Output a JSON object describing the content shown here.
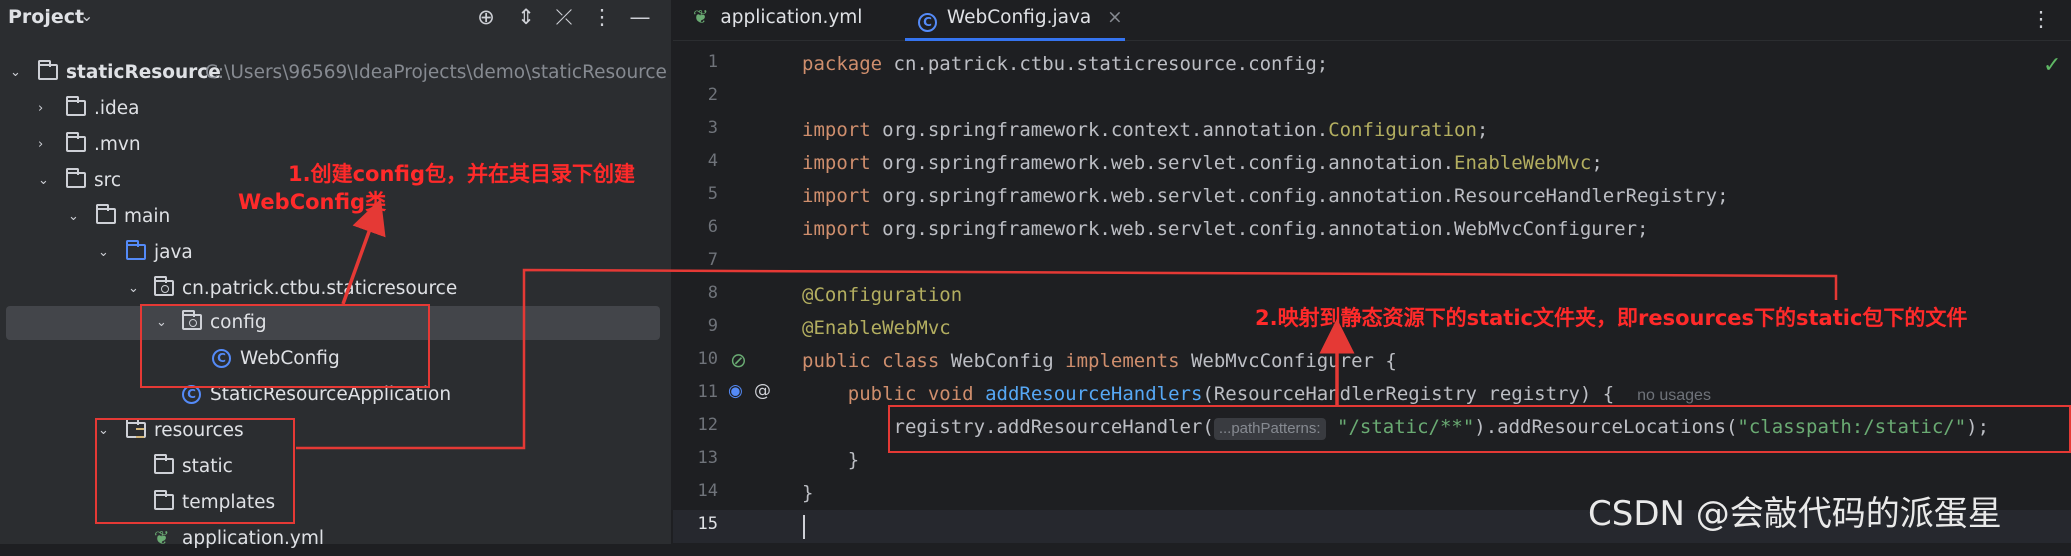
{
  "project_panel": {
    "title": "Project",
    "tree": [
      {
        "label": "staticResource",
        "path": "C:\\Users\\96569\\IdeaProjects\\demo\\staticResource"
      },
      {
        "label": ".idea"
      },
      {
        "label": ".mvn"
      },
      {
        "label": "src"
      },
      {
        "label": "main"
      },
      {
        "label": "java"
      },
      {
        "label": "cn.patrick.ctbu.staticresource"
      },
      {
        "label": "config"
      },
      {
        "label": "WebConfig"
      },
      {
        "label": "StaticResourceApplication"
      },
      {
        "label": "resources"
      },
      {
        "label": "static"
      },
      {
        "label": "templates"
      },
      {
        "label": "application.yml"
      }
    ]
  },
  "editor": {
    "tabs": [
      {
        "label": "application.yml",
        "active": false
      },
      {
        "label": "WebConfig.java",
        "active": true
      }
    ],
    "line_numbers": [
      "1",
      "2",
      "3",
      "4",
      "5",
      "6",
      "7",
      "8",
      "9",
      "10",
      "11",
      "12",
      "13",
      "14",
      "15"
    ],
    "code": {
      "l1_kw": "package",
      "l1_rest": " cn.patrick.ctbu.staticresource.config;",
      "import_kw": "import",
      "l3_pre": " org.springframework.context.annotation.",
      "l3_cls": "Configuration",
      "l4_pre": " org.springframework.web.servlet.config.annotation.",
      "l4_cls": "EnableWebMvc",
      "l5_rest": " org.springframework.web.servlet.config.annotation.ResourceHandlerRegistry;",
      "l6_rest": " org.springframework.web.servlet.config.annotation.WebMvcConfigurer;",
      "semicolon": ";",
      "l8": "@Configuration",
      "l9": "@EnableWebMvc",
      "l10_kw1": "public class",
      "l10_name": " WebConfig ",
      "l10_kw2": "implements",
      "l10_rest": " WebMvcConfigurer {",
      "l11_kw": "public void",
      "l11_fn": "addResourceHandlers",
      "l11_rest": "(ResourceHandlerRegistry registry) {",
      "l11_hint": "no usages",
      "l12_pre": "registry.addResourceHandler(",
      "l12_param_hint": "...pathPatterns:",
      "l12_str1": "\"/static/**\"",
      "l12_mid": ").addResourceLocations(",
      "l12_str2": "\"classpath:/static/\"",
      "l12_end": ");",
      "l13": "}",
      "l14": "}"
    }
  },
  "annotations": {
    "note1_line1": "1.创建config包，并在其目录下创建",
    "note1_line2": "WebConfig类",
    "note2": "2.映射到静态资源下的static文件夹，即resources下的static包下的文件",
    "color": "#ff2a2a"
  },
  "watermark": "CSDN @会敲代码的派蛋星"
}
